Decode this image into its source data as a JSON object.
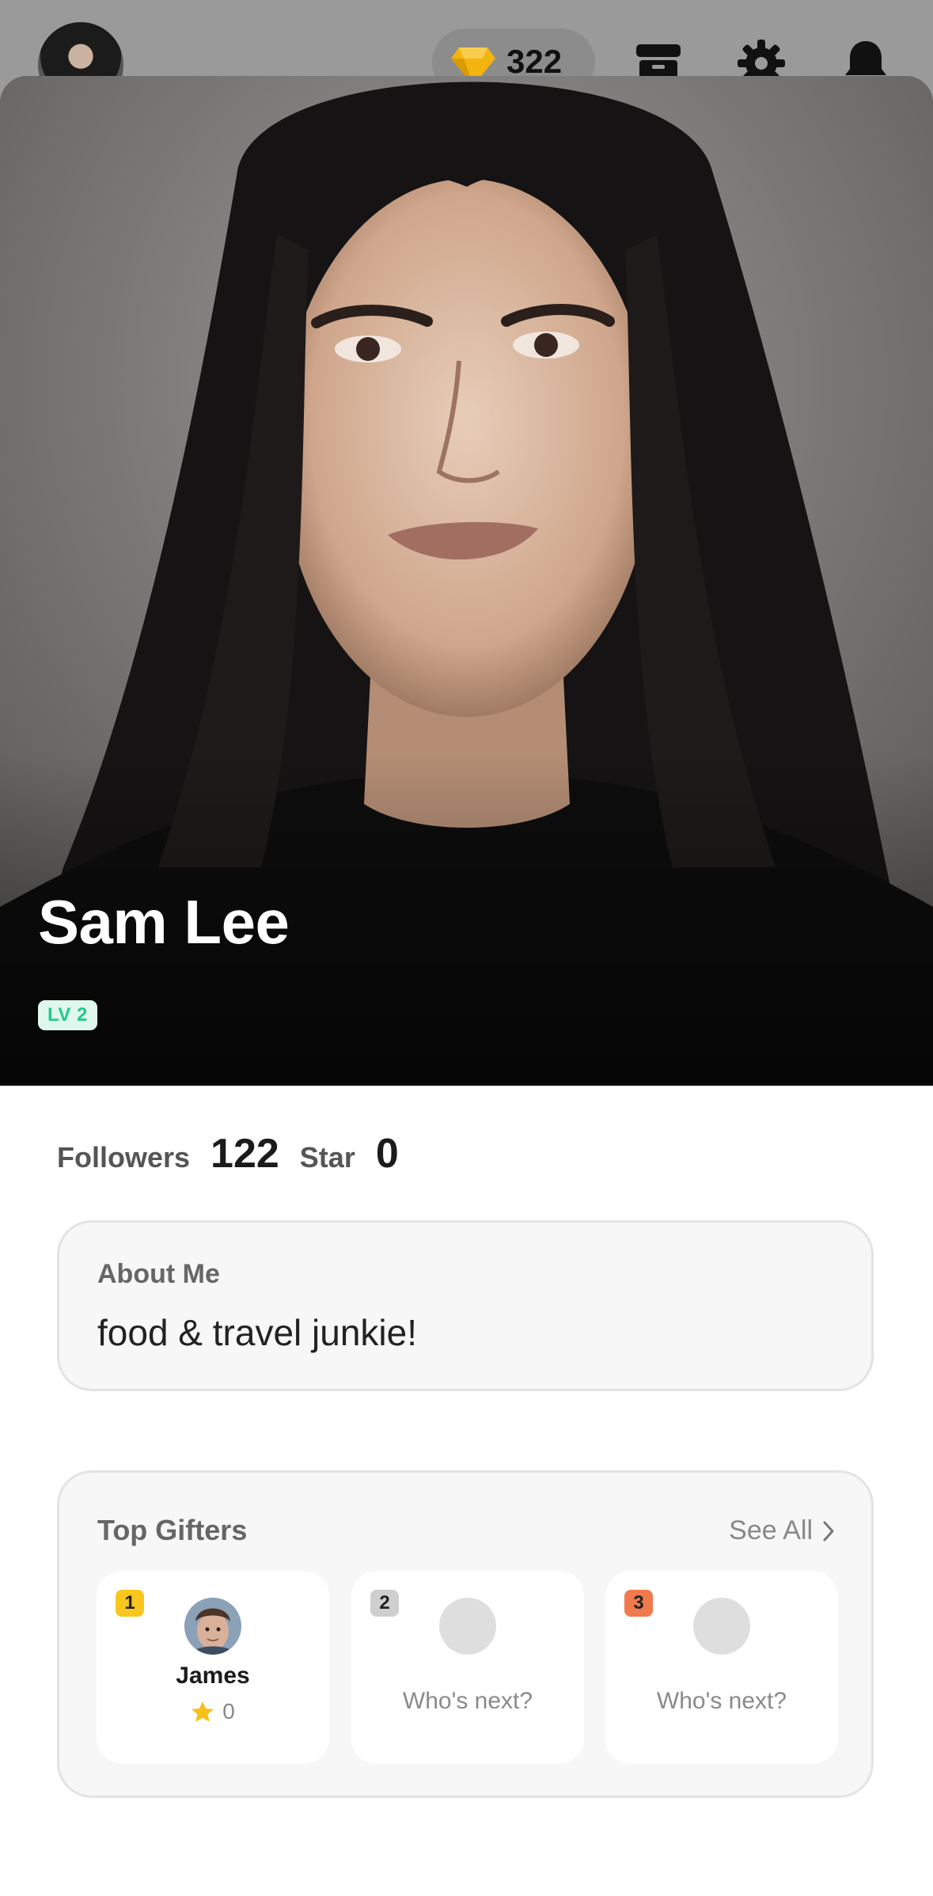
{
  "header": {
    "gems": "322",
    "icons": {
      "avatar": "user-avatar",
      "gem": "gem-icon",
      "archive": "archive-icon",
      "settings": "gear-icon",
      "notifications": "bell-icon"
    }
  },
  "profile": {
    "name": "Sam Lee",
    "level": "LV 2"
  },
  "stats": {
    "followers_label": "Followers",
    "followers_value": "122",
    "star_label": "Star",
    "star_value": "0"
  },
  "about": {
    "title": "About Me",
    "text": "food & travel junkie!"
  },
  "gifters": {
    "title": "Top Gifters",
    "see_all": "See All",
    "slots": [
      {
        "rank": "1",
        "name": "James",
        "stars": "0"
      },
      {
        "rank": "2",
        "placeholder": "Who's next?"
      },
      {
        "rank": "3",
        "placeholder": "Who's next?"
      }
    ]
  },
  "colors": {
    "level_bg": "#dff7ed",
    "level_text": "#22c98a",
    "rank1": "#f8c61c",
    "rank2": "#cfcfcf",
    "rank3": "#f07a4e",
    "gem": "#f3b40f",
    "star": "#f6c21a"
  }
}
